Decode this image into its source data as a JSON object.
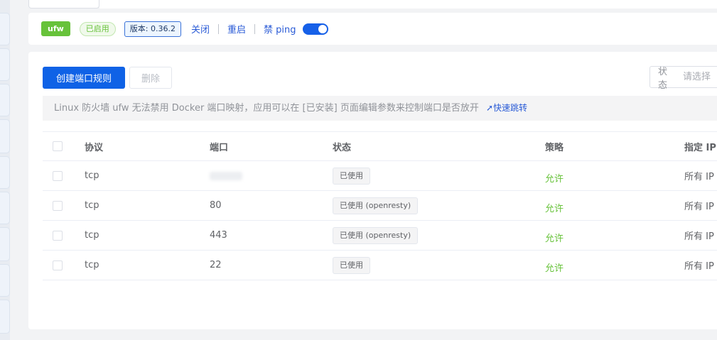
{
  "toolbar": {
    "ufw_tag": "ufw",
    "enabled_tag": "已启用",
    "version": "版本: 0.36.2",
    "close": "关闭",
    "restart": "重启",
    "ban_ping": "禁 ping",
    "ban_ping_on": true
  },
  "actions": {
    "create": "创建端口规则",
    "delete": "删除"
  },
  "filter": {
    "label": "状态",
    "placeholder": "请选择"
  },
  "notice": {
    "text": "Linux 防火墙 ufw 无法禁用 Docker 端口映射，应用可以在 [已安装] 页面编辑参数来控制端口是否放开",
    "link": "快速跳转"
  },
  "table": {
    "headers": {
      "protocol": "协议",
      "port": "端口",
      "status": "状态",
      "strategy": "策略",
      "ip": "指定 IP"
    },
    "rows": [
      {
        "protocol": "tcp",
        "port": "",
        "status": "已使用",
        "strategy": "允许",
        "ip": "所有 IP"
      },
      {
        "protocol": "tcp",
        "port": "80",
        "status": "已使用 (openresty)",
        "strategy": "允许",
        "ip": "所有 IP"
      },
      {
        "protocol": "tcp",
        "port": "443",
        "status": "已使用 (openresty)",
        "strategy": "允许",
        "ip": "所有 IP"
      },
      {
        "protocol": "tcp",
        "port": "22",
        "status": "已使用",
        "strategy": "允许",
        "ip": "所有 IP"
      }
    ]
  },
  "colors": {
    "primary": "#0f62e6",
    "success": "#67c23a",
    "link": "#2a5bd6"
  }
}
